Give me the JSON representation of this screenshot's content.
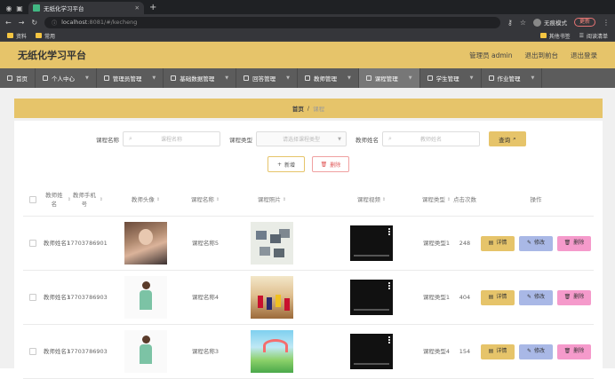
{
  "browser": {
    "tab_title": "无纸化学习平台",
    "url_host": "localhost",
    "url_path": ":8081/#/kecheng",
    "incognito_label": "无痕模式",
    "update_label": "更新",
    "bookmarks": [
      "资料",
      "常用"
    ],
    "bookmarks_right": [
      "其他书签",
      "阅读清单"
    ]
  },
  "header": {
    "title": "无纸化学习平台",
    "user": "管理员 admin",
    "back_to_front": "退出到前台",
    "logout": "退出登录"
  },
  "nav": [
    {
      "label": "首页",
      "has_menu": false,
      "active": false
    },
    {
      "label": "个人中心",
      "has_menu": true,
      "active": false
    },
    {
      "label": "管理员管理",
      "has_menu": true,
      "active": false
    },
    {
      "label": "基础数据管理",
      "has_menu": true,
      "active": false
    },
    {
      "label": "回答管理",
      "has_menu": true,
      "active": false
    },
    {
      "label": "教师管理",
      "has_menu": true,
      "active": false
    },
    {
      "label": "课程管理",
      "has_menu": true,
      "active": true
    },
    {
      "label": "学生管理",
      "has_menu": true,
      "active": false
    },
    {
      "label": "作业管理",
      "has_menu": true,
      "active": false
    }
  ],
  "breadcrumb": {
    "home": "首页",
    "sep": "/",
    "current": "课程"
  },
  "search": {
    "course_name_label": "课程名称",
    "course_name_placeholder": "课程名称",
    "course_type_label": "课程类型",
    "course_type_placeholder": "请选择课程类型",
    "teacher_name_label": "教师姓名",
    "teacher_name_placeholder": "教师姓名",
    "search_button": "查询"
  },
  "actions": {
    "add": "新增",
    "delete": "删除"
  },
  "table": {
    "headers": {
      "teacher_name": "教师姓名",
      "teacher_phone": "教师手机号",
      "avatar": "教师头像",
      "course_name": "课程名称",
      "course_image": "课程照片",
      "course_video": "课程视频",
      "course_type": "课程类型",
      "clicks": "点击次数",
      "ops": "操作"
    },
    "rows": [
      {
        "teacher_name": "教师姓名1",
        "phone": "17703786901",
        "course_name": "课程名称5",
        "course_type": "课程类型1",
        "clicks": "248"
      },
      {
        "teacher_name": "教师姓名3",
        "phone": "17703786903",
        "course_name": "课程名称4",
        "course_type": "课程类型1",
        "clicks": "404"
      },
      {
        "teacher_name": "教师姓名3",
        "phone": "17703786903",
        "course_name": "课程名称3",
        "course_type": "课程类型4",
        "clicks": "154"
      }
    ],
    "op_labels": {
      "detail": "详情",
      "edit": "修改",
      "delete": "删除"
    }
  }
}
